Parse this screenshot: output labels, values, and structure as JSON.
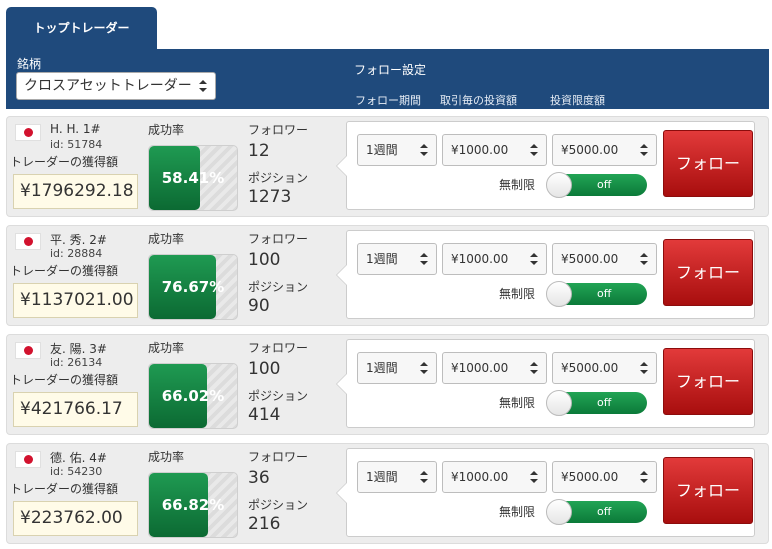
{
  "tab": {
    "label": "トップトレーダー"
  },
  "header": {
    "symbol_label": "銘柄",
    "symbol_value": "クロスアセットトレーダー",
    "follow_settings_label": "フォロー設定",
    "col_period": "フォロー期間",
    "col_per_trade": "取引毎の投資額",
    "col_limit": "投資限度額"
  },
  "labels": {
    "earnings": "トレーダーの獲得額",
    "success_rate": "成功率",
    "followers": "フォロワー",
    "positions": "ポジション",
    "unlimited": "無制限",
    "toggle_state": "off",
    "follow_button": "フォロー"
  },
  "traders": [
    {
      "name": "H. H.   1#",
      "id": "id: 51784",
      "earnings": "¥1796292.18",
      "success_rate": "58.41%",
      "success_rate_value": 58.41,
      "followers": "12",
      "positions": "1273",
      "period": "1週間",
      "per_trade": "¥1000.00",
      "limit": "¥5000.00"
    },
    {
      "name": "平. 秀.   2#",
      "id": "id: 28884",
      "earnings": "¥1137021.00",
      "success_rate": "76.67%",
      "success_rate_value": 76.67,
      "followers": "100",
      "positions": "90",
      "period": "1週間",
      "per_trade": "¥1000.00",
      "limit": "¥5000.00"
    },
    {
      "name": "友. 陽.   3#",
      "id": "id: 26134",
      "earnings": "¥421766.17",
      "success_rate": "66.02%",
      "success_rate_value": 66.02,
      "followers": "100",
      "positions": "414",
      "period": "1週間",
      "per_trade": "¥1000.00",
      "limit": "¥5000.00"
    },
    {
      "name": "德. 佑.   4#",
      "id": "id: 54230",
      "earnings": "¥223762.00",
      "success_rate": "66.82%",
      "success_rate_value": 66.82,
      "followers": "36",
      "positions": "216",
      "period": "1週間",
      "per_trade": "¥1000.00",
      "limit": "¥5000.00"
    }
  ],
  "colors": {
    "header_bg": "#1f4a7c",
    "success_green": "#0c6a33",
    "follow_red": "#c61f1f",
    "earnings_bg": "#fffbe8"
  }
}
